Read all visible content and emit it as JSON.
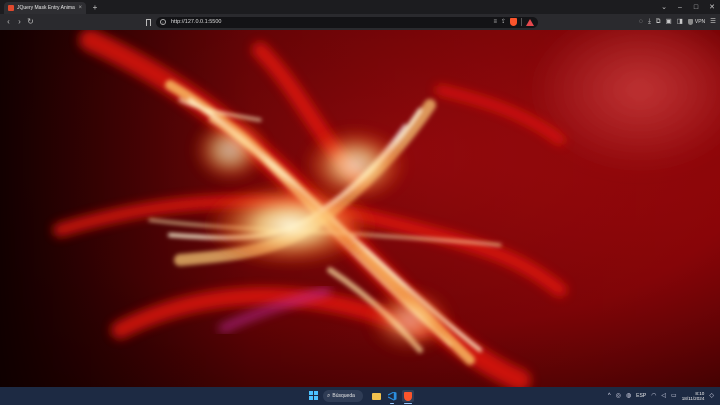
{
  "browser": {
    "tab": {
      "title": "JQuery Mask Entry Animation",
      "close_icon": "×"
    },
    "new_tab_icon": "+",
    "window_controls": {
      "dropdown": "⌄",
      "minimize": "–",
      "maximize": "□",
      "close": "✕"
    },
    "nav": {
      "back": "‹",
      "forward": "›",
      "reload": "↻"
    },
    "address": {
      "url": "http://127.0.0.1:5500"
    },
    "toolbar_icons": [
      "reader-mode-icon",
      "share-icon",
      "brave-shield-icon",
      "brave-rewards-icon",
      "leo-icon",
      "downloads-icon",
      "extensions-icon",
      "wallet-icon",
      "sidebar-icon",
      "vpn-icon",
      "menu-icon"
    ],
    "vpn_label": "VPN"
  },
  "page": {
    "background_colors": {
      "dark": "#1a0000",
      "red": "#b00a0c",
      "accent": "#e01a10",
      "glow": "#fff3c4"
    }
  },
  "taskbar": {
    "search_label": "Búsqueda",
    "apps": [
      "file-explorer-icon",
      "vscode-icon",
      "brave-browser-icon"
    ],
    "tray": {
      "language": "ESP",
      "time": "8:10",
      "date": "18/11/2024"
    }
  }
}
